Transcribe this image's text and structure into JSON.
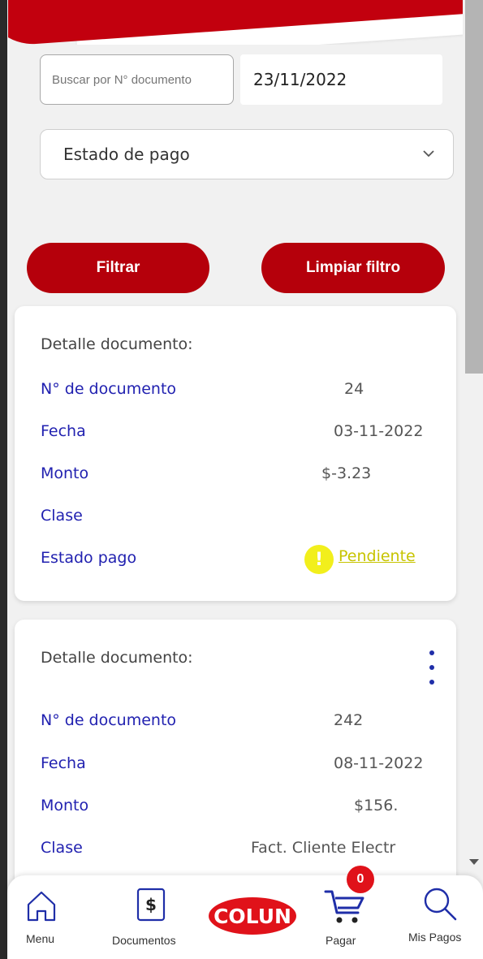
{
  "search": {
    "placeholder": "Buscar por N° documento",
    "date_value": "23/11/2022"
  },
  "status_select": {
    "selected": "Estado de pago"
  },
  "buttons": {
    "filter": "Filtrar",
    "clear": "Limpiar filtro"
  },
  "documents": [
    {
      "title": "Detalle documento:",
      "labels": {
        "number": "N° de documento",
        "date": "Fecha",
        "amount": "Monto",
        "class": "Clase",
        "status": "Estado pago"
      },
      "number": "24",
      "date": "03-11-2022",
      "amount": "$-3.23",
      "class": "",
      "status": "Pendiente",
      "status_icon": "!",
      "status_color": "#c7c400"
    },
    {
      "title": "Detalle documento:",
      "labels": {
        "number": "N° de documento",
        "date": "Fecha",
        "amount": "Monto",
        "class": "Clase"
      },
      "number": "242",
      "date": "08-11-2022",
      "amount": "$156.",
      "class": "Fact. Cliente Electr"
    }
  ],
  "nav": {
    "menu": "Menu",
    "documents": "Documentos",
    "pay": "Pagar",
    "my_payments": "Mis Pagos",
    "cart_count": "0",
    "brand": "COLUN"
  },
  "colors": {
    "brand_red": "#c2000e",
    "button_red": "#b5000b",
    "label_blue": "#2121b0",
    "pending_yellow": "#f2ef1c"
  }
}
